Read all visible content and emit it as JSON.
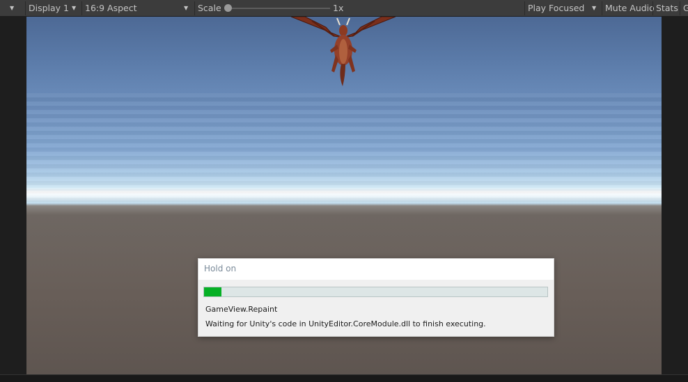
{
  "toolbar": {
    "display": "Display 1",
    "aspect": "16:9 Aspect",
    "scale_label": "Scale",
    "scale_value": "1x",
    "play_mode": "Play Focused",
    "mute_audio": "Mute Audio",
    "stats": "Stats",
    "gizmos_partial": "G"
  },
  "dialog": {
    "title": "Hold on",
    "progress": 0.05,
    "operation": "GameView.Repaint",
    "message": "Waiting for Unity's code in UnityEditor.CoreModule.dll to finish executing."
  },
  "colors": {
    "progress_fill": "#06b025",
    "toolbar_bg": "#3c3c3c",
    "sky_top": "#4d6995",
    "ground": "#685e58"
  },
  "icons": [
    "dropdown-arrow-icon",
    "slider-thumb",
    "dragon-model"
  ]
}
